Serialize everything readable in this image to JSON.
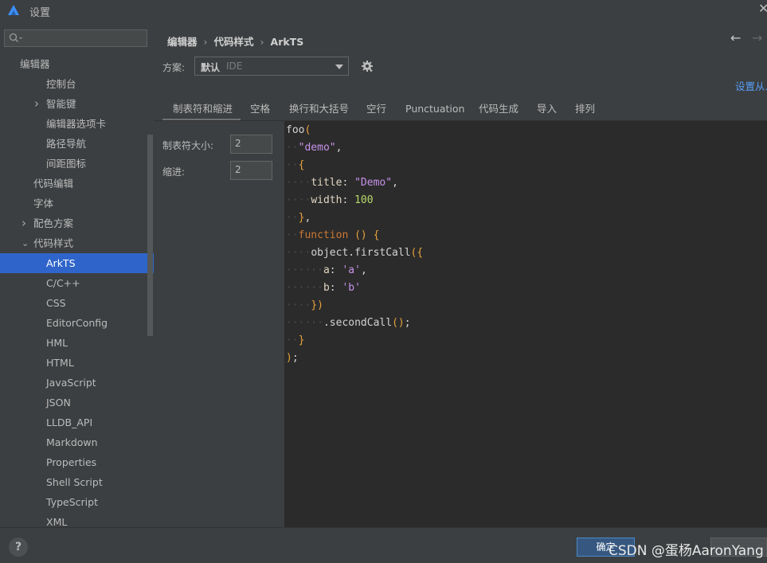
{
  "window": {
    "title": "设置"
  },
  "sidebar": {
    "search_placeholder": "",
    "items": [
      {
        "label": "编辑器",
        "level": 0,
        "chevron": "",
        "selected": false
      },
      {
        "label": "控制台",
        "level": 2,
        "chevron": "",
        "selected": false
      },
      {
        "label": "智能键",
        "level": 2,
        "chevron": "right",
        "selected": false
      },
      {
        "label": "编辑器选项卡",
        "level": 2,
        "chevron": "",
        "selected": false
      },
      {
        "label": "路径导航",
        "level": 2,
        "chevron": "",
        "selected": false
      },
      {
        "label": "间距图标",
        "level": 2,
        "chevron": "",
        "selected": false
      },
      {
        "label": "代码编辑",
        "level": 1,
        "chevron": "",
        "selected": false
      },
      {
        "label": "字体",
        "level": 1,
        "chevron": "",
        "selected": false
      },
      {
        "label": "配色方案",
        "level": 1,
        "chevron": "right",
        "selected": false
      },
      {
        "label": "代码样式",
        "level": 1,
        "chevron": "down",
        "selected": false
      },
      {
        "label": "ArkTS",
        "level": 2,
        "chevron": "",
        "selected": true
      },
      {
        "label": "C/C++",
        "level": 2,
        "chevron": "",
        "selected": false
      },
      {
        "label": "CSS",
        "level": 2,
        "chevron": "",
        "selected": false
      },
      {
        "label": "EditorConfig",
        "level": 2,
        "chevron": "",
        "selected": false
      },
      {
        "label": "HML",
        "level": 2,
        "chevron": "",
        "selected": false
      },
      {
        "label": "HTML",
        "level": 2,
        "chevron": "",
        "selected": false
      },
      {
        "label": "JavaScript",
        "level": 2,
        "chevron": "",
        "selected": false
      },
      {
        "label": "JSON",
        "level": 2,
        "chevron": "",
        "selected": false
      },
      {
        "label": "LLDB_API",
        "level": 2,
        "chevron": "",
        "selected": false
      },
      {
        "label": "Markdown",
        "level": 2,
        "chevron": "",
        "selected": false
      },
      {
        "label": "Properties",
        "level": 2,
        "chevron": "",
        "selected": false
      },
      {
        "label": "Shell Script",
        "level": 2,
        "chevron": "",
        "selected": false
      },
      {
        "label": "TypeScript",
        "level": 2,
        "chevron": "",
        "selected": false
      },
      {
        "label": "XML",
        "level": 2,
        "chevron": "",
        "selected": false
      }
    ]
  },
  "breadcrumb": [
    "编辑器",
    "代码样式",
    "ArkTS"
  ],
  "scheme": {
    "label": "方案:",
    "value": "默认",
    "sub": "IDE",
    "set_from": "设置从..."
  },
  "tabs": [
    {
      "label": "制表符和缩进",
      "active": true
    },
    {
      "label": "空格",
      "active": false
    },
    {
      "label": "换行和大括号",
      "active": false
    },
    {
      "label": "空行",
      "active": false
    },
    {
      "label": "Punctuation",
      "active": false
    },
    {
      "label": "代码生成",
      "active": false
    },
    {
      "label": "导入",
      "active": false
    },
    {
      "label": "排列",
      "active": false
    }
  ],
  "options": {
    "tab_size": {
      "label": "制表符大小:",
      "value": "2"
    },
    "indent": {
      "label": "缩进:",
      "value": "2"
    }
  },
  "code_preview": [
    [
      [
        "plain",
        "foo"
      ],
      [
        "paren",
        "("
      ]
    ],
    [
      [
        "dots",
        "··"
      ],
      [
        "str",
        "\"demo\""
      ],
      [
        "plain",
        ","
      ]
    ],
    [
      [
        "dots",
        "··"
      ],
      [
        "paren",
        "{"
      ]
    ],
    [
      [
        "dots",
        "····"
      ],
      [
        "prop",
        "title"
      ],
      [
        "plain",
        ": "
      ],
      [
        "str",
        "\"Demo\""
      ],
      [
        "plain",
        ","
      ]
    ],
    [
      [
        "dots",
        "····"
      ],
      [
        "prop",
        "width"
      ],
      [
        "plain",
        ": "
      ],
      [
        "num",
        "100"
      ]
    ],
    [
      [
        "dots",
        "··"
      ],
      [
        "paren",
        "}"
      ],
      [
        "plain",
        ","
      ]
    ],
    [
      [
        "dots",
        "··"
      ],
      [
        "kw",
        "function"
      ],
      [
        "plain",
        " "
      ],
      [
        "paren",
        "()"
      ],
      [
        "plain",
        " "
      ],
      [
        "paren",
        "{"
      ]
    ],
    [
      [
        "dots",
        "····"
      ],
      [
        "plain",
        "object.firstCall"
      ],
      [
        "paren",
        "({"
      ]
    ],
    [
      [
        "dots",
        "······"
      ],
      [
        "prop",
        "a"
      ],
      [
        "plain",
        ": "
      ],
      [
        "str",
        "'a'"
      ],
      [
        "plain",
        ","
      ]
    ],
    [
      [
        "dots",
        "······"
      ],
      [
        "prop",
        "b"
      ],
      [
        "plain",
        ": "
      ],
      [
        "str",
        "'b'"
      ]
    ],
    [
      [
        "dots",
        "····"
      ],
      [
        "paren",
        "})"
      ]
    ],
    [
      [
        "dots",
        "······"
      ],
      [
        "plain",
        ".secondCall"
      ],
      [
        "paren",
        "()"
      ],
      [
        "plain",
        ";"
      ]
    ],
    [
      [
        "dots",
        "··"
      ],
      [
        "paren",
        "}"
      ]
    ],
    [
      [
        "paren",
        ")"
      ],
      [
        "plain",
        ";"
      ]
    ]
  ],
  "footer": {
    "help": "?",
    "ok_label": "确定",
    "watermark": "CSDN @蛋杨AaronYang"
  },
  "colors": {
    "selection": "#2f65ca",
    "link": "#589df6",
    "editor_bg": "#2b2b2b",
    "panel_bg": "#3c3f41"
  }
}
